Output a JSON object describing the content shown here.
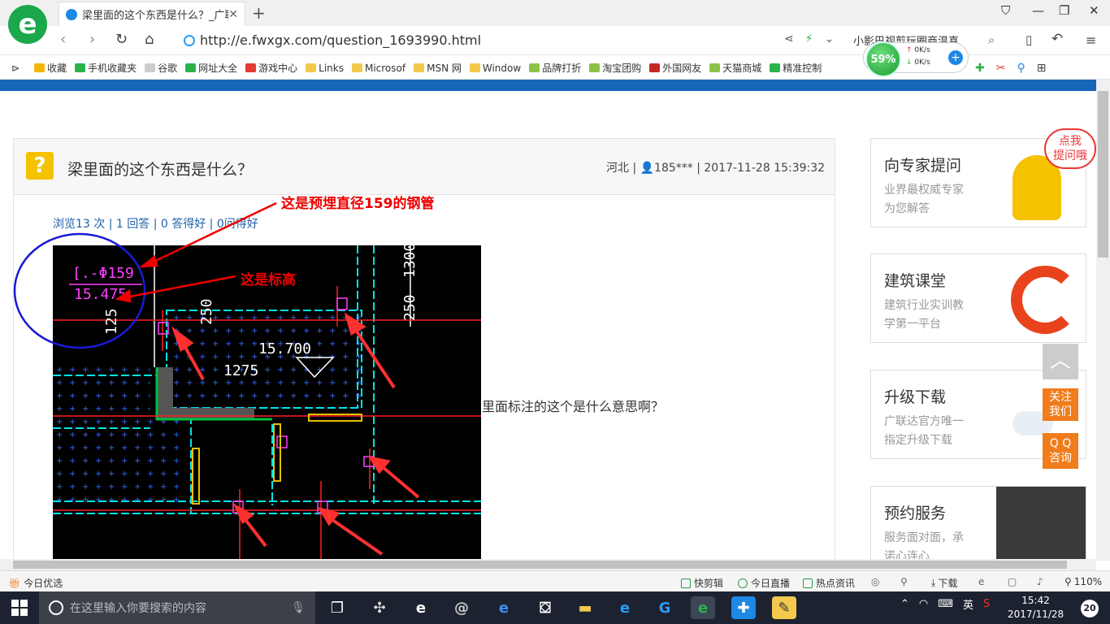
{
  "browser": {
    "tab_title": "梁里面的这个东西是什么？_广联",
    "url": "http://e.fwxgx.com/question_1693990.html",
    "search_text": "小影巴视剪玩圈商温真",
    "speed_percent": "59%",
    "speed_up": "0K/s",
    "speed_down": "0K/s"
  },
  "bookmarks": [
    {
      "label": "收藏",
      "color": "#f2b705"
    },
    {
      "label": "手机收藏夹",
      "color": "#2bb34b"
    },
    {
      "label": "谷歌",
      "color": "#888888"
    },
    {
      "label": "网址大全",
      "color": "#2bb34b"
    },
    {
      "label": "游戏中心",
      "color": "#e53935"
    },
    {
      "label": "Links",
      "color": "#f2c94c"
    },
    {
      "label": "Microsof",
      "color": "#f2c94c"
    },
    {
      "label": "MSN 网",
      "color": "#f2c94c"
    },
    {
      "label": "Window",
      "color": "#f2c94c"
    },
    {
      "label": "品牌打折",
      "color": "#8bc34a"
    },
    {
      "label": "淘宝团购",
      "color": "#8bc34a"
    },
    {
      "label": "外国网友",
      "color": "#c62828"
    },
    {
      "label": "天猫商城",
      "color": "#8bc34a"
    },
    {
      "label": "精准控制",
      "color": "#2bb34b"
    }
  ],
  "question": {
    "title": "梁里面的这个东西是什么？",
    "meta": "河北 | 👤185*** | 2017-11-28 15:39:32",
    "stats": "浏览13 次 | 1 回答 | 0 答得好 | 0问得好",
    "text": "里面标注的这个是什么意思啊？",
    "annotation_pipe": "这是预埋直径159的钢管",
    "annotation_elevation": "这是标高",
    "cad_label_pipe": "[.-Φ159",
    "cad_label_elev": "15.475",
    "cad_label_1275": "1275",
    "cad_label_15700": "15.700",
    "cad_label_250a": "250",
    "cad_label_250b": "250",
    "cad_label_125": "125",
    "cad_label_1300": "1300"
  },
  "sidebar": {
    "bubble": "点我\n提问哦",
    "cards": [
      {
        "title": "向专家提问",
        "line1": "业界最权威专家",
        "line2": "为您解答"
      },
      {
        "title": "建筑课堂",
        "line1": "建筑行业实训教",
        "line2": "学第一平台"
      },
      {
        "title": "升级下载",
        "line1": "广联达官方唯一",
        "line2": "指定升级下载"
      },
      {
        "title": "预约服务",
        "line1": "服务面对面，承",
        "line2": "诺心连心"
      }
    ],
    "float_follow": "关注\n我们",
    "float_qq": "Q Q\n咨询"
  },
  "statusbar": {
    "left": "今日优选",
    "kuaijian": "快剪辑",
    "live": "今日直播",
    "news": "热点资讯",
    "download": "下载",
    "zoom": "110%"
  },
  "taskbar": {
    "search_placeholder": "在这里输入你要搜索的内容",
    "ime": "英",
    "time": "15:42",
    "date": "2017/11/28",
    "notifications": "20"
  }
}
